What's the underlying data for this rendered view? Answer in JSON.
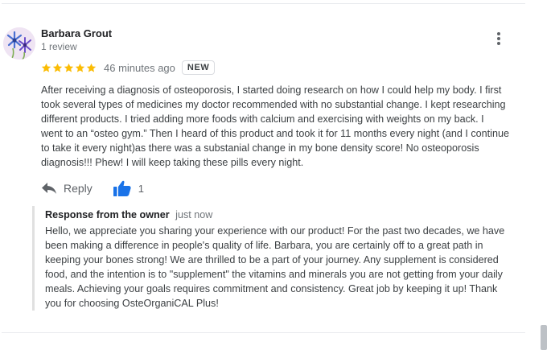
{
  "review": {
    "author": "Barbara Grout",
    "author_meta": "1 review",
    "rating": 5,
    "max_rating": 5,
    "time": "46 minutes ago",
    "badge": "NEW",
    "text": "After receiving a diagnosis of osteoporosis, I started doing research on how I could help my body. I first\ntook several types of medicines my doctor recommended with no substantial change. I kept researching\ndifferent products. I tried adding more foods with calcium and exercising with weights on my back. I\nwent to an “osteo gym.” Then I heard of this product and took it for 11 months every night (and I continue\nto take it every night)as there was a substanial change in my bone density score! No osteoporosis\ndiagnosis!!! Phew! I will keep taking these pills every night.",
    "reply_label": "Reply",
    "like_count": "1",
    "star_color": "#fbbc04",
    "like_color": "#1a73e8"
  },
  "owner_response": {
    "title": "Response from the owner",
    "time": "just now",
    "text": "Hello, we appreciate you sharing your experience with our product! For the past two decades, we have\nbeen making a difference in people's quality of life. Barbara, you are certainly off to a great path in\nkeeping your bones strong! We are thrilled to be a part of your journey. Any supplement is considered\nfood, and the intention is to \"supplement\" the vitamins and minerals you are not getting from your daily\nmeals. Achieving your goals requires commitment and consistency. Great job by keeping it up! Thank\nyou for choosing OsteOrganiCAL Plus!"
  },
  "icons": {
    "avatar": "flower-avatar",
    "more": "more-vert-icon",
    "star": "star-icon",
    "reply": "reply-icon",
    "like": "thumbs-up-icon"
  }
}
